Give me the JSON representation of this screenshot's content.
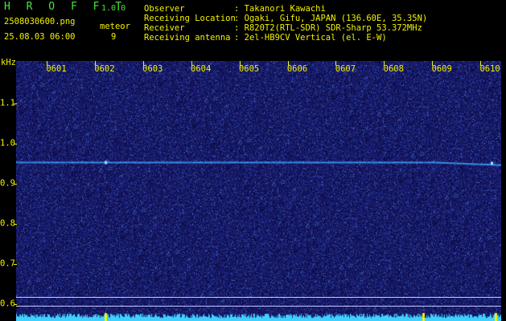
{
  "header": {
    "app_name": "H R O F F T",
    "version": "1.0.0",
    "filename": "2508030600.png",
    "datetime": "25.08.03 06:00",
    "meteor_label": "meteor",
    "meteor_count": "9",
    "info": [
      {
        "label": "Observer",
        "value": ": Takanori Kawachi"
      },
      {
        "label": "Receiving Location",
        "value": ": Ogaki, Gifu, JAPAN (136.60E, 35.35N)"
      },
      {
        "label": "Receiver",
        "value": ": R820T2(RTL-SDR) SDR-Sharp 53.372MHz"
      },
      {
        "label": "Receiving antenna",
        "value": ": 2el-HB9CV Vertical (el. E-W)"
      }
    ]
  },
  "spectrogram": {
    "y_unit": "kHz",
    "time_ticks": [
      "0601",
      "0602",
      "0603",
      "0604",
      "0605",
      "0606",
      "0607",
      "0608",
      "0609",
      "0610"
    ],
    "freq_ticks": [
      "1.1",
      "1.0",
      "0.9",
      "0.8",
      "0.7",
      "0.6"
    ],
    "background_color": "#1a1a64",
    "carrier_color": "#3fa0ff",
    "carrier_freq_khz": 0.955,
    "ref_line_freqs_khz": [
      0.62,
      0.6
    ]
  }
}
